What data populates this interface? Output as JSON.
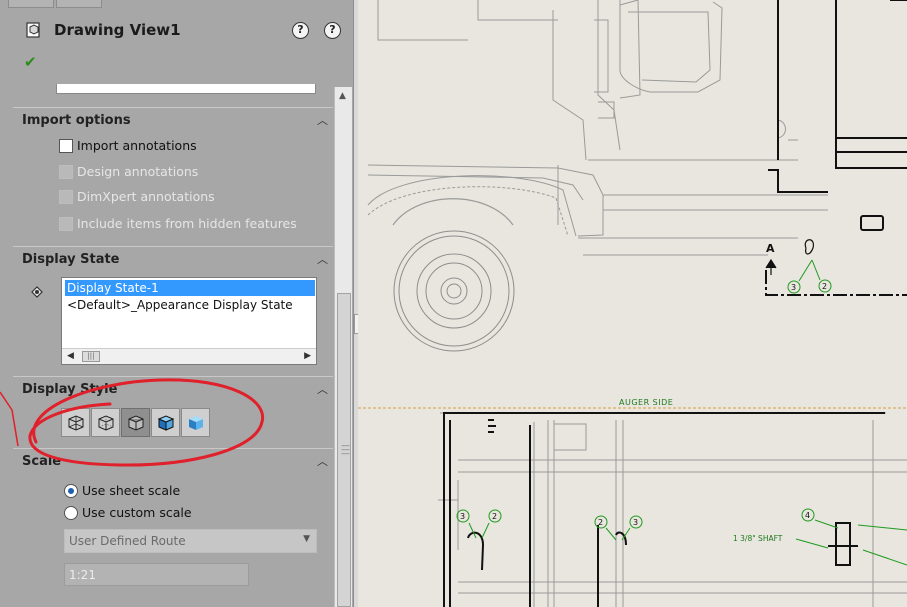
{
  "property_manager": {
    "title": "Drawing View1",
    "help_icons": [
      "whats-new-help-icon",
      "help-icon"
    ],
    "help_glyphs": [
      "?",
      "?"
    ],
    "ok_glyph": "✔",
    "import_options": {
      "title": "Import options",
      "items": [
        {
          "label": "Import annotations",
          "checked": false,
          "enabled": true
        },
        {
          "label": "Design annotations",
          "checked": false,
          "enabled": false
        },
        {
          "label": "DimXpert annotations",
          "checked": false,
          "enabled": false
        },
        {
          "label": "Include items from hidden features",
          "checked": false,
          "enabled": false
        }
      ]
    },
    "display_state": {
      "title": "Display State",
      "items": [
        "Display State-1",
        "<Default>_Appearance Display State"
      ],
      "selected_index": 0
    },
    "display_style": {
      "title": "Display Style",
      "buttons": [
        "wireframe",
        "hidden-lines-visible",
        "hidden-lines-removed",
        "shaded-with-edges",
        "shaded"
      ],
      "active_index": 2
    },
    "scale": {
      "title": "Scale",
      "options": [
        "Use sheet scale",
        "Use custom scale"
      ],
      "selected_index": 0,
      "dropdown_value": "User Defined Route",
      "custom_value": "1:21"
    }
  },
  "drawing": {
    "view_label": "AUGER SIDE",
    "shaft_note": "1 3/8\" SHAFT",
    "section_letter": "A",
    "balloons": [
      "3",
      "2",
      "3",
      "2",
      "2",
      "3",
      "4"
    ]
  },
  "colors": {
    "panel_bg": "#a7a7a7",
    "selection": "#3399ff",
    "annotation_green": "#1f9a1f",
    "markup_red": "#e0202a",
    "sheet_bg": "#e8e6de"
  }
}
